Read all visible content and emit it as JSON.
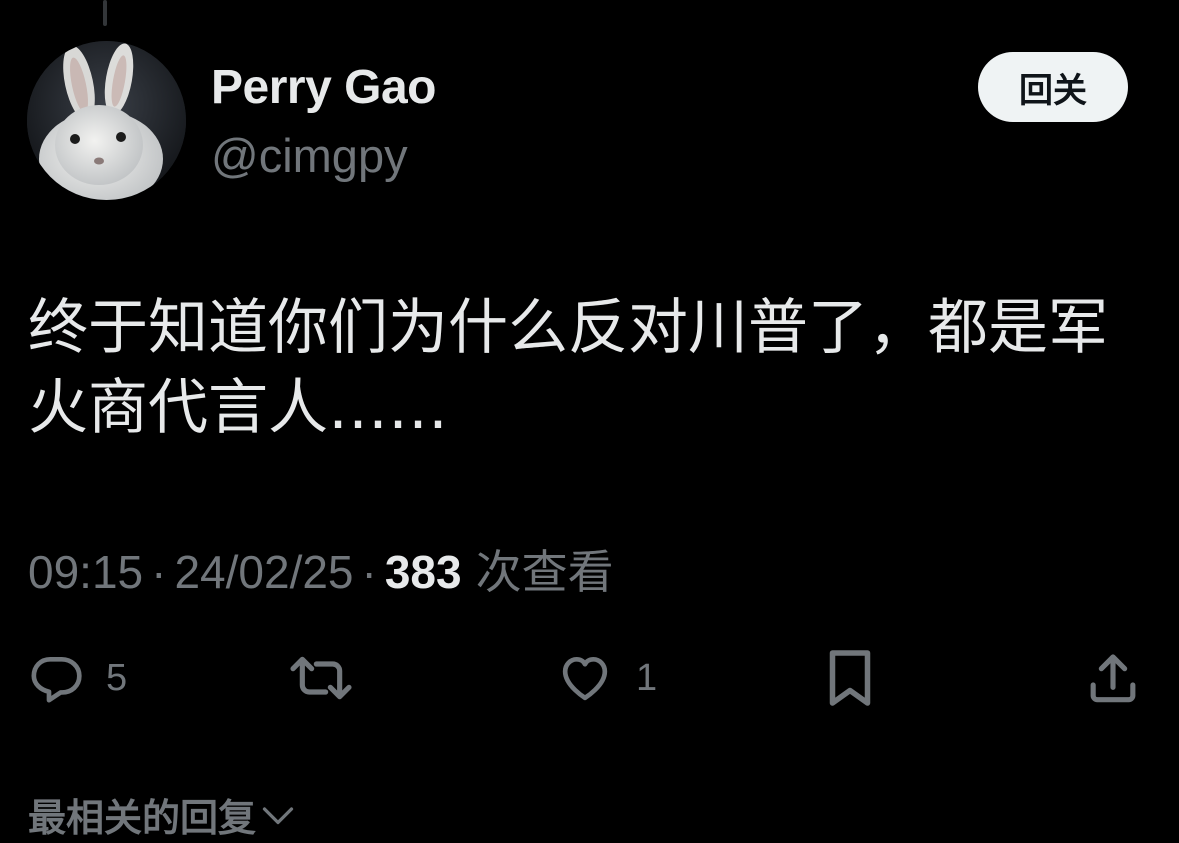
{
  "author": {
    "display_name": "Perry Gao",
    "handle": "@cimgpy",
    "avatar": "rabbit-avatar"
  },
  "follow_button": {
    "label": "回关"
  },
  "tweet": {
    "text": "终于知道你们为什么反对川普了，都是军\n火商代言人……"
  },
  "meta": {
    "time": "09:15",
    "separator": "·",
    "date": "24/02/25",
    "views": "383",
    "views_label": "次查看"
  },
  "actions": {
    "reply": {
      "icon": "reply-icon",
      "count": "5"
    },
    "retweet": {
      "icon": "retweet-icon",
      "count": ""
    },
    "like": {
      "icon": "heart-icon",
      "count": "1"
    },
    "bookmark": {
      "icon": "bookmark-icon"
    },
    "share": {
      "icon": "share-icon"
    }
  },
  "replies_sort": {
    "label": "最相关的回复",
    "icon": "chevron-down-icon"
  },
  "colors": {
    "background": "#000000",
    "primary_text": "#e7e9ea",
    "secondary_text": "#71767b",
    "button_bg": "#eff3f4"
  }
}
